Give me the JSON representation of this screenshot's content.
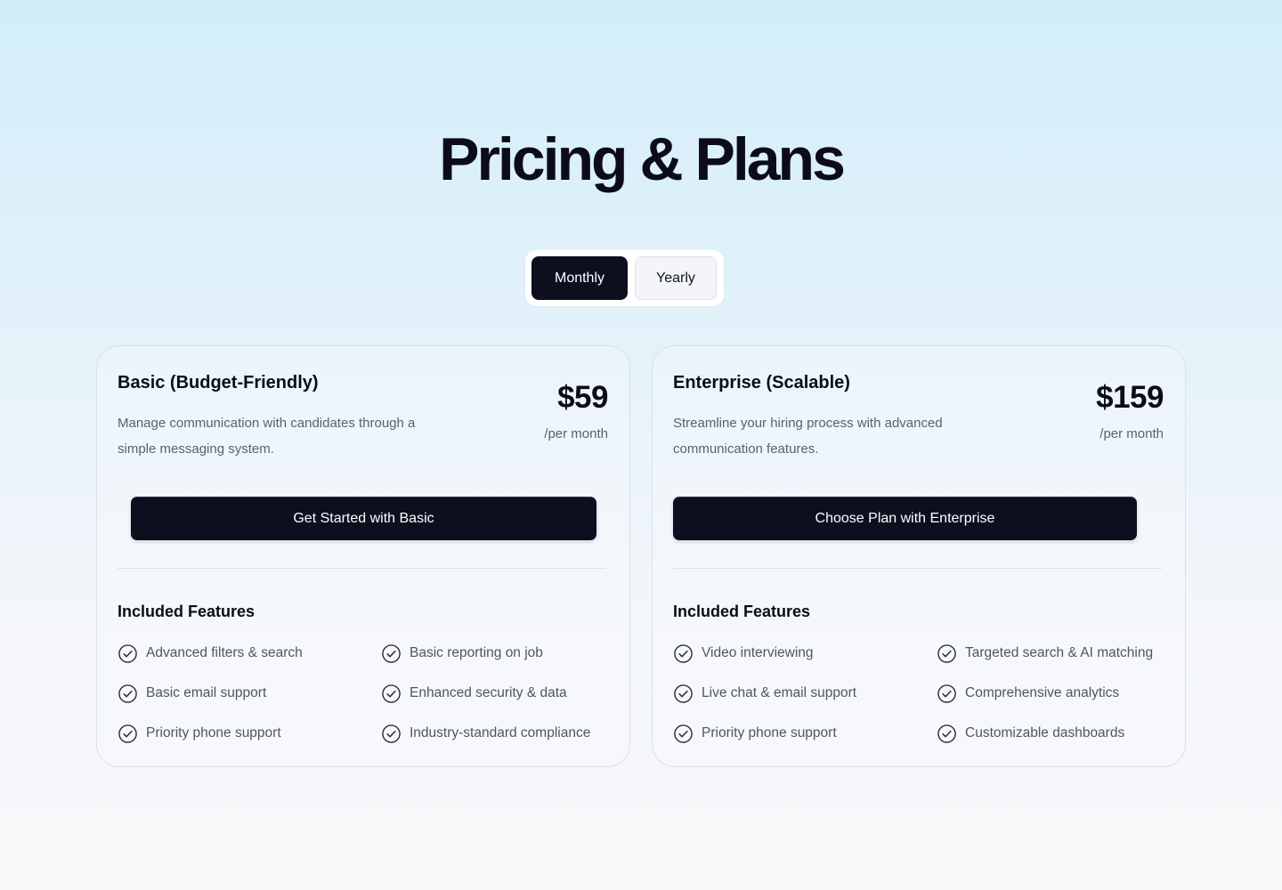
{
  "page": {
    "title": "Pricing & Plans"
  },
  "billing_toggle": {
    "options": [
      {
        "label": "Monthly",
        "active": true
      },
      {
        "label": "Yearly",
        "active": false
      }
    ]
  },
  "plans": [
    {
      "name": "Basic (Budget-Friendly)",
      "description": "Manage communication with candidates through a simple messaging system.",
      "price": "$59",
      "period": "/per month",
      "cta_label": "Get Started with Basic",
      "features_title": "Included Features",
      "features": [
        "Advanced filters & search",
        "Basic reporting on job",
        "Basic email support",
        "Enhanced security & data",
        "Priority phone support",
        "Industry-standard compliance"
      ]
    },
    {
      "name": "Enterprise (Scalable)",
      "description": "Streamline your hiring process with advanced communication features.",
      "price": "$159",
      "period": "/per month",
      "cta_label": "Choose Plan with Enterprise",
      "features_title": "Included Features",
      "features": [
        "Video interviewing",
        "Targeted search & AI matching",
        "Live chat & email support",
        "Comprehensive analytics",
        "Priority phone support",
        "Customizable dashboards"
      ]
    }
  ],
  "colors": {
    "primary_dark": "#0e0f1e",
    "text_muted": "#5a6070",
    "background_top": "#d2edfa",
    "background_bottom": "#f8f8fa"
  },
  "icons": {
    "feature_icon": "check-circle-icon"
  }
}
